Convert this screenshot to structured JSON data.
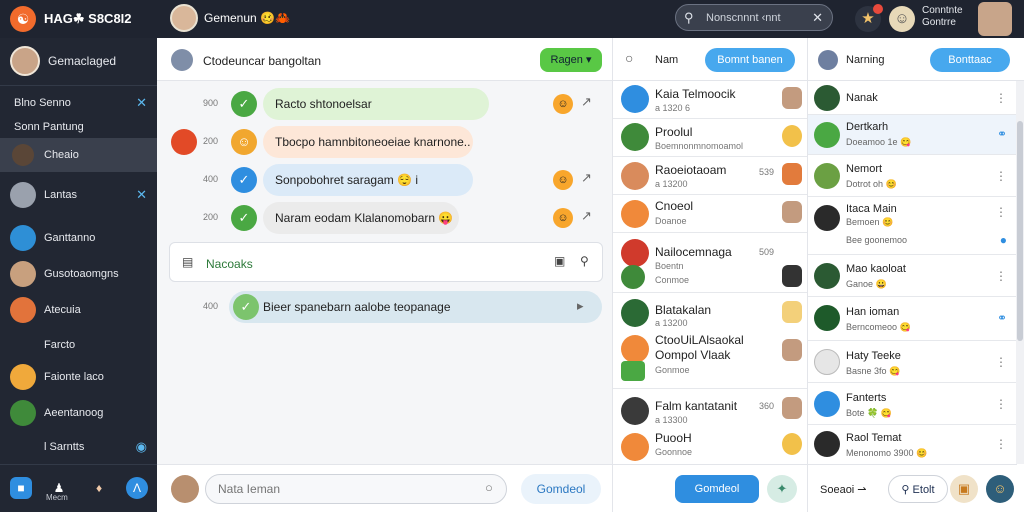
{
  "topbar": {
    "app_name": "HAG☘ S8C8I2",
    "chat_title": "Gemenun 🥴🦀",
    "search_placeholder": "Nonscnnnt ‹nnt",
    "status_line1": "Conntnte",
    "status_line2": "Gontrre",
    "icons": [
      "logo-icon",
      "search-icon",
      "clear-icon",
      "notifications-icon",
      "emoji-icon"
    ]
  },
  "sidebar": {
    "me_name": "Gemaclaged",
    "items": [
      {
        "label": "Blno  Senno",
        "closable": true
      },
      {
        "label": "Sonn  Pantung",
        "closable": false
      },
      {
        "label": "Cheaio",
        "closable": false,
        "active": true
      },
      {
        "label": "Lantas",
        "closable": true
      },
      {
        "label": "Ganttanno",
        "closable": false
      },
      {
        "label": "Gusotoaomgns",
        "closable": false
      },
      {
        "label": "Atecuia",
        "closable": false
      },
      {
        "label": "Farcto",
        "closable": false
      },
      {
        "label": "Faionte laco",
        "closable": false
      },
      {
        "label": "Aeentanoog",
        "closable": false
      },
      {
        "label": "l  Sarntts",
        "closable": false
      }
    ],
    "bottom_labels": [
      "",
      "Mecm",
      "",
      ""
    ]
  },
  "chat": {
    "title": "Ctodeuncar bangoltan",
    "action_button": "Ragen",
    "messages": [
      {
        "time": "900",
        "text": "Racto shtonoelsar",
        "color": "#dff3d6"
      },
      {
        "time": "200",
        "text": "Tbocpo hamnbitoneoeiae knarnone..",
        "color": "#fde7d8"
      },
      {
        "time": "400",
        "text": "Sonpobohret saragam 😌 i",
        "color": "#dbeaf8"
      },
      {
        "time": "200",
        "text": "Naram eodam Klalanomobarn 😛",
        "color": "#ebebeb"
      }
    ],
    "card_title": "Nacoaks",
    "quoted_time": "400",
    "quoted_text": "Bieer spanebarn aalobe teopanage",
    "composer_placeholder": "Nata Ieman",
    "composer_button": "Gomdeol"
  },
  "contacts": {
    "header": "Nam",
    "header_button": "Bomnt banen",
    "items": [
      {
        "name": "Kaia Telmoocik",
        "sub": "а 1320 6",
        "time": ""
      },
      {
        "name": "Proolul",
        "sub": "Boemnonmnomoamol",
        "time": ""
      },
      {
        "name": "Raoeiotaoam",
        "sub": "а 13200",
        "time": "539"
      },
      {
        "name": "Cnoeol",
        "sub": "Doanoe",
        "time": ""
      },
      {
        "name": "Nailocemnaga",
        "sub": "Boentn",
        "time": "509"
      },
      {
        "name": "",
        "sub": "Conmoe",
        "time": ""
      },
      {
        "name": "Blatakalan",
        "sub": "а 13200",
        "time": ""
      },
      {
        "name": "CtooUiLAlsaokal",
        "sub": "",
        "time": ""
      },
      {
        "name": "Oompol Vlaak",
        "sub": "Gonmoe",
        "time": ""
      },
      {
        "name": "Falm kantatanit",
        "sub": "а 13300",
        "time": "360"
      },
      {
        "name": "PuooH",
        "sub": "Goonnoe",
        "time": ""
      }
    ]
  },
  "notifications": {
    "header": "Narning",
    "header_button": "Bonttaac",
    "items": [
      {
        "name": "Nanak",
        "sub": ""
      },
      {
        "name": "Dertkarh",
        "sub": "Doeamoo 1е 😋"
      },
      {
        "name": "Nemort",
        "sub": "Dotrot oh 😊"
      },
      {
        "name": "Itaca Main",
        "sub": "Bemoen 😊"
      },
      {
        "name": "",
        "sub": "Bee goonemoo"
      },
      {
        "name": "Mao kaoloat",
        "sub": "Ganoe 😀"
      },
      {
        "name": "Han ioman",
        "sub": "Berncomeoo 😋"
      },
      {
        "name": "Haty Teeke",
        "sub": "Basne 3fo 😋"
      },
      {
        "name": "Fanterts",
        "sub": "Bote 🍀 😋"
      },
      {
        "name": "Raol Temat",
        "sub": "Menonomo 3900 😊"
      }
    ],
    "footer_label": "Soeaoi ⇀",
    "footer_button": "Etolt"
  }
}
